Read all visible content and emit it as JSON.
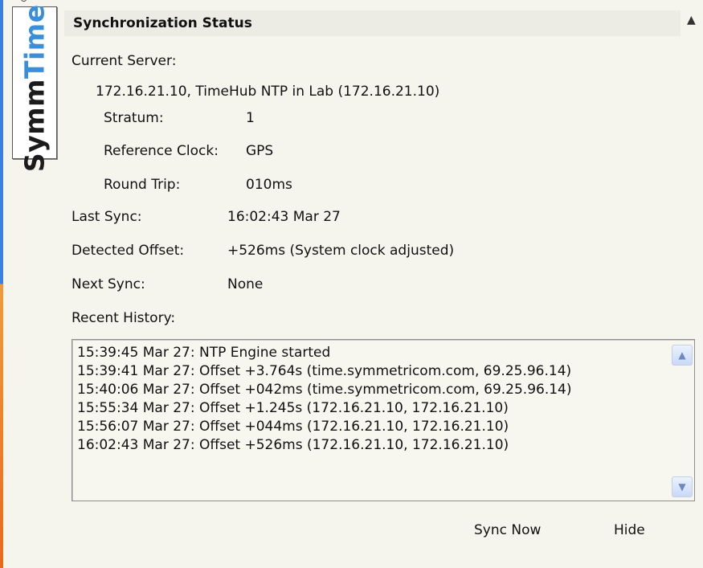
{
  "logo": {
    "symm": "Symm",
    "time": "Time",
    "reg": "®"
  },
  "header": {
    "title": "Synchronization Status",
    "collapse_icon": "▲"
  },
  "current_server": {
    "label": "Current Server:",
    "value": "172.16.21.10, TimeHub NTP in Lab (172.16.21.10)",
    "stratum_label": "Stratum:",
    "stratum_value": "1",
    "ref_label": "Reference Clock:",
    "ref_value": "GPS",
    "rt_label": "Round Trip:",
    "rt_value": "010ms"
  },
  "last_sync": {
    "label": "Last Sync:",
    "value": "16:02:43 Mar 27"
  },
  "detected_offset": {
    "label": "Detected Offset:",
    "value": "+526ms (System clock adjusted)"
  },
  "next_sync": {
    "label": "Next Sync:",
    "value": "None"
  },
  "history": {
    "label": "Recent History:",
    "entries": [
      "15:39:45 Mar 27: NTP Engine started",
      "15:39:41 Mar 27: Offset +3.764s  (time.symmetricom.com, 69.25.96.14)",
      "15:40:06 Mar 27: Offset +042ms  (time.symmetricom.com, 69.25.96.14)",
      "15:55:34 Mar 27: Offset +1.245s  (172.16.21.10, 172.16.21.10)",
      "15:56:07 Mar 27: Offset +044ms  (172.16.21.10, 172.16.21.10)",
      "16:02:43 Mar 27: Offset +526ms  (172.16.21.10, 172.16.21.10)"
    ]
  },
  "buttons": {
    "sync_now": "Sync Now",
    "hide": "Hide"
  }
}
